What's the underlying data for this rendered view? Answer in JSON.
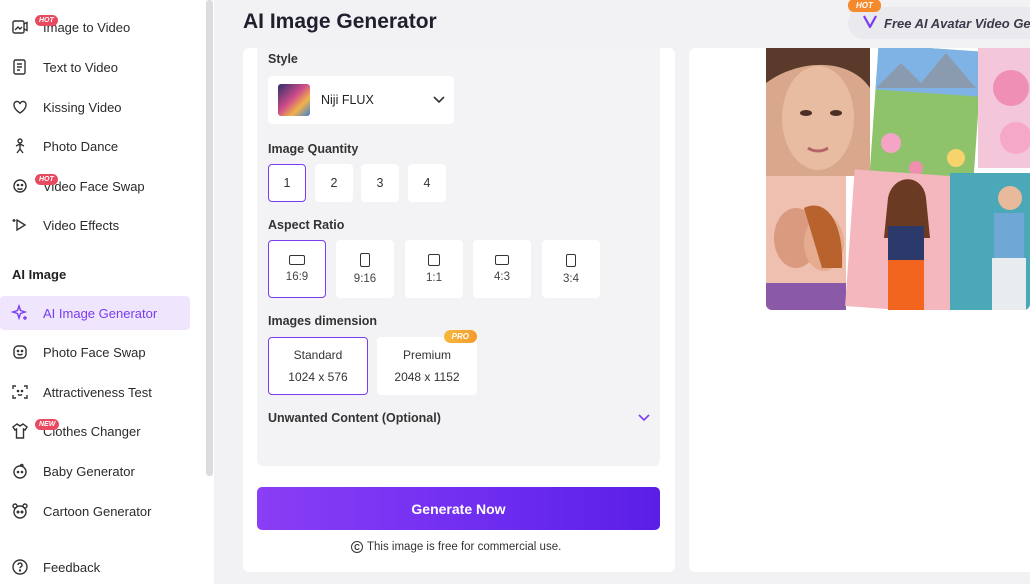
{
  "header": {
    "title": "AI Image Generator",
    "promo_badge": "HOT",
    "promo_text": "Free AI Avatar Video Ge"
  },
  "sidebar": {
    "items": [
      {
        "label": "Image to Video",
        "icon": "image-video-icon",
        "badge": "HOT"
      },
      {
        "label": "Text to Video",
        "icon": "text-document-icon",
        "badge": ""
      },
      {
        "label": "Kissing Video",
        "icon": "hearts-icon",
        "badge": ""
      },
      {
        "label": "Photo Dance",
        "icon": "dance-icon",
        "badge": ""
      },
      {
        "label": "Video Face Swap",
        "icon": "face-swap-icon",
        "badge": "HOT"
      },
      {
        "label": "Video Effects",
        "icon": "sparkle-play-icon",
        "badge": ""
      }
    ],
    "section_title": "AI Image",
    "image_items": [
      {
        "label": "AI Image Generator",
        "icon": "magic-sparkle-icon",
        "badge": "",
        "active": true
      },
      {
        "label": "Photo Face Swap",
        "icon": "face-icon",
        "badge": ""
      },
      {
        "label": "Attractiveness Test",
        "icon": "face-scan-icon",
        "badge": ""
      },
      {
        "label": "Clothes Changer",
        "icon": "shirt-icon",
        "badge": "NEW"
      },
      {
        "label": "Baby Generator",
        "icon": "baby-icon",
        "badge": ""
      },
      {
        "label": "Cartoon Generator",
        "icon": "cartoon-face-icon",
        "badge": ""
      }
    ],
    "feedback": "Feedback"
  },
  "form": {
    "style_label": "Style",
    "style_value": "Niji FLUX",
    "quantity_label": "Image Quantity",
    "quantities": [
      "1",
      "2",
      "3",
      "4"
    ],
    "quantity_selected": "1",
    "aspect_label": "Aspect Ratio",
    "aspects": [
      "16:9",
      "9:16",
      "1:1",
      "4:3",
      "3:4"
    ],
    "aspect_selected": "16:9",
    "dimension_label": "Images dimension",
    "dimensions": [
      {
        "name": "Standard",
        "size": "1024 x 576",
        "badge": ""
      },
      {
        "name": "Premium",
        "size": "2048 x 1152",
        "badge": "PRO"
      }
    ],
    "dimension_selected": "Standard",
    "unwanted_label": "Unwanted Content (Optional)",
    "generate_label": "Generate Now",
    "notice": "This image is free for commercial use."
  },
  "colors": {
    "accent": "#7a3cf0",
    "hot_badge": "#e84a5f",
    "pro_badge": "#f6b93b",
    "promo_badge": "#f58a2c"
  }
}
